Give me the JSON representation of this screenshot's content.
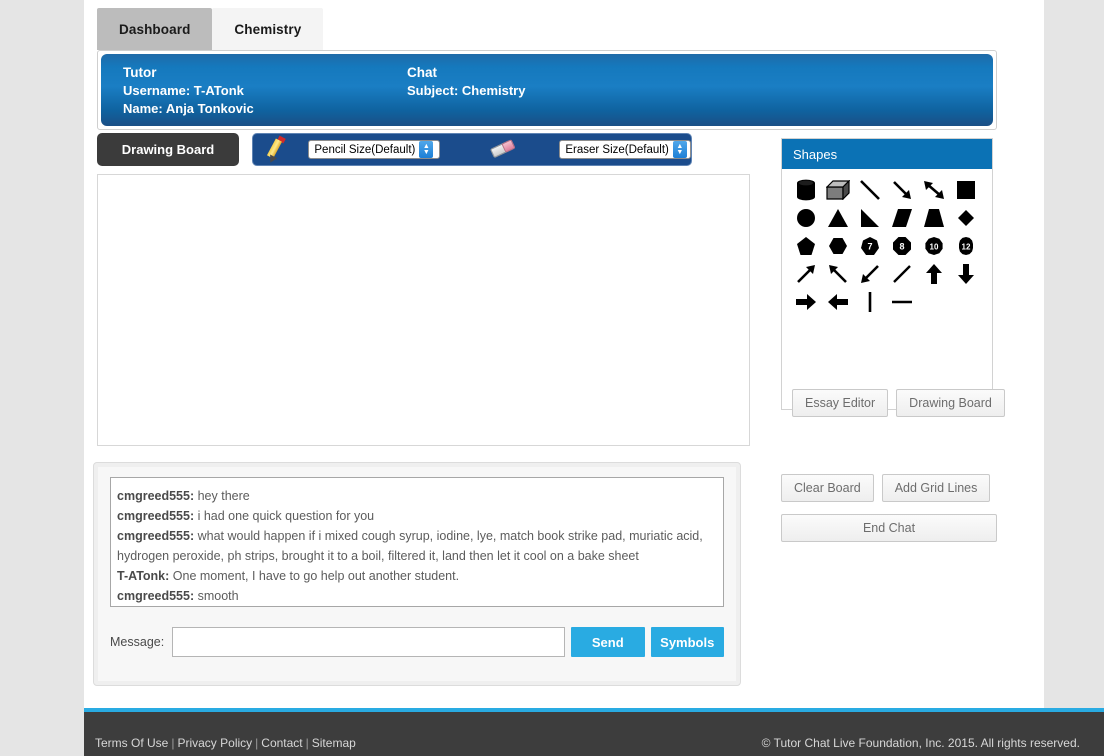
{
  "tabs": [
    {
      "label": "Dashboard",
      "active": false
    },
    {
      "label": "Chemistry",
      "active": true
    }
  ],
  "info_header": {
    "tutor": {
      "title": "Tutor",
      "username": "Username: T-ATonk",
      "name": "Name: Anja Tonkovic"
    },
    "chat": {
      "title": "Chat",
      "subject": "Subject: Chemistry"
    }
  },
  "toolbar": {
    "board_tab_label": "Drawing Board",
    "pencil_icon": "pencil-icon",
    "pencil_size_value": "Pencil Size(Default)",
    "eraser_icon": "eraser-icon",
    "eraser_size_value": "Eraser Size(Default)"
  },
  "shapes_panel": {
    "header": "Shapes",
    "shapes": [
      {
        "name": "cylinder"
      },
      {
        "name": "cube"
      },
      {
        "name": "line-diagonal"
      },
      {
        "name": "arrow-down-right"
      },
      {
        "name": "double-arrow"
      },
      {
        "name": "square"
      },
      {
        "name": "circle"
      },
      {
        "name": "triangle"
      },
      {
        "name": "right-triangle"
      },
      {
        "name": "parallelogram"
      },
      {
        "name": "trapezoid"
      },
      {
        "name": "diamond"
      },
      {
        "name": "pentagon"
      },
      {
        "name": "hexagon"
      },
      {
        "name": "heptagon",
        "label": "7"
      },
      {
        "name": "octagon",
        "label": "8"
      },
      {
        "name": "decagon",
        "label": "10"
      },
      {
        "name": "dodecagon",
        "label": "12"
      },
      {
        "name": "arrow-up-right"
      },
      {
        "name": "arrow-up-left"
      },
      {
        "name": "arrow-down-left"
      },
      {
        "name": "line-slash"
      },
      {
        "name": "arrow-up"
      },
      {
        "name": "arrow-down"
      },
      {
        "name": "arrow-right"
      },
      {
        "name": "arrow-left"
      },
      {
        "name": "vertical-line"
      },
      {
        "name": "horizontal-line"
      }
    ],
    "essay_editor_label": "Essay Editor",
    "drawing_board_label": "Drawing Board"
  },
  "board_actions": {
    "clear_board_label": "Clear Board",
    "add_grid_lines_label": "Add Grid Lines",
    "end_chat_label": "End Chat"
  },
  "chat": {
    "messages": [
      {
        "user": "cmgreed555:",
        "text": " hey there"
      },
      {
        "user": "cmgreed555:",
        "text": " i had one quick question for you"
      },
      {
        "user": "cmgreed555:",
        "text": " what would happen if i mixed cough syrup, iodine, lye, match book strike pad, muriatic acid, hydrogen peroxide, ph strips, brought it to a boil, filtered it, land then let it cool on a bake sheet"
      },
      {
        "user": "T-ATonk:",
        "text": " One moment, I have to go help out another student."
      },
      {
        "user": "cmgreed555:",
        "text": " smooth"
      }
    ],
    "message_label": "Message:",
    "message_value": "",
    "message_placeholder": "",
    "send_label": "Send",
    "symbols_label": "Symbols"
  },
  "footer": {
    "links": [
      "Terms Of Use",
      "Privacy Policy",
      "Contact",
      "Sitemap"
    ],
    "separator": "|",
    "copyright": "© Tutor Chat Live Foundation, Inc. 2015. All rights reserved."
  },
  "colors": {
    "page_bg": "#e5e5e5",
    "accent_blue": "#29abe2",
    "header_blue": "#1a7ec4",
    "shapes_header_blue": "#0b72b5",
    "toolbar_navy": "#1b4c8c",
    "dark_tab": "#3b3b3b",
    "footer_dark": "#3d3d3d"
  }
}
